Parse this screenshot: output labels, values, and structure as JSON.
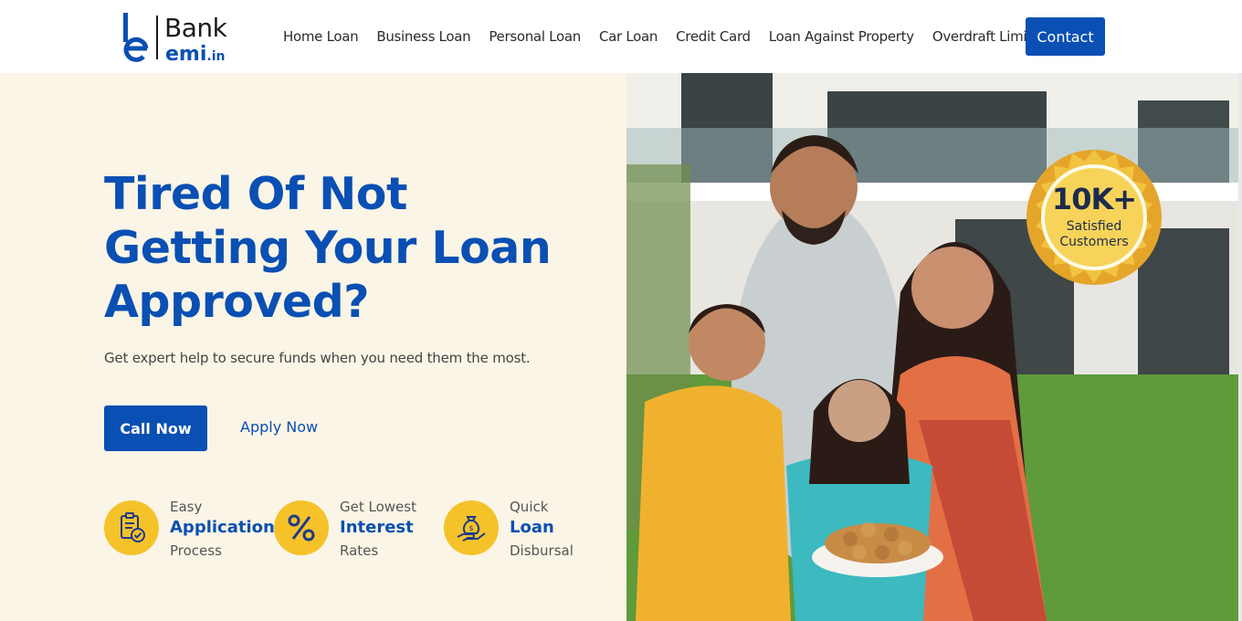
{
  "header": {
    "logo_bank": "Bank",
    "logo_emi": "emi",
    "logo_domain": ".in",
    "nav": [
      "Home Loan",
      "Business Loan",
      "Personal Loan",
      "Car Loan",
      "Credit Card",
      "Loan Against Property",
      "Overdraft Limit"
    ],
    "contact_label": "Contact"
  },
  "hero": {
    "title": "Tired Of Not Getting Your Loan Approved?",
    "subtitle": "Get expert help to secure funds when you need them the most.",
    "call_label": "Call Now",
    "apply_label": "Apply Now",
    "features": [
      {
        "line1": "Easy",
        "line2": "Application",
        "line3": "Process",
        "icon": "clipboard-check-icon"
      },
      {
        "line1": "Get Lowest",
        "line2": "Interest",
        "line3": "Rates",
        "icon": "percent-icon"
      },
      {
        "line1": "Quick",
        "line2": "Loan",
        "line3": "Disbursal",
        "icon": "money-bag-hand-icon"
      }
    ]
  },
  "badge": {
    "count": "10K+",
    "line1": "Satisfied",
    "line2": "Customers"
  },
  "colors": {
    "brand_blue": "#0a4fb3",
    "hero_bg": "#faf5e6",
    "icon_gold": "#f5c22a"
  }
}
